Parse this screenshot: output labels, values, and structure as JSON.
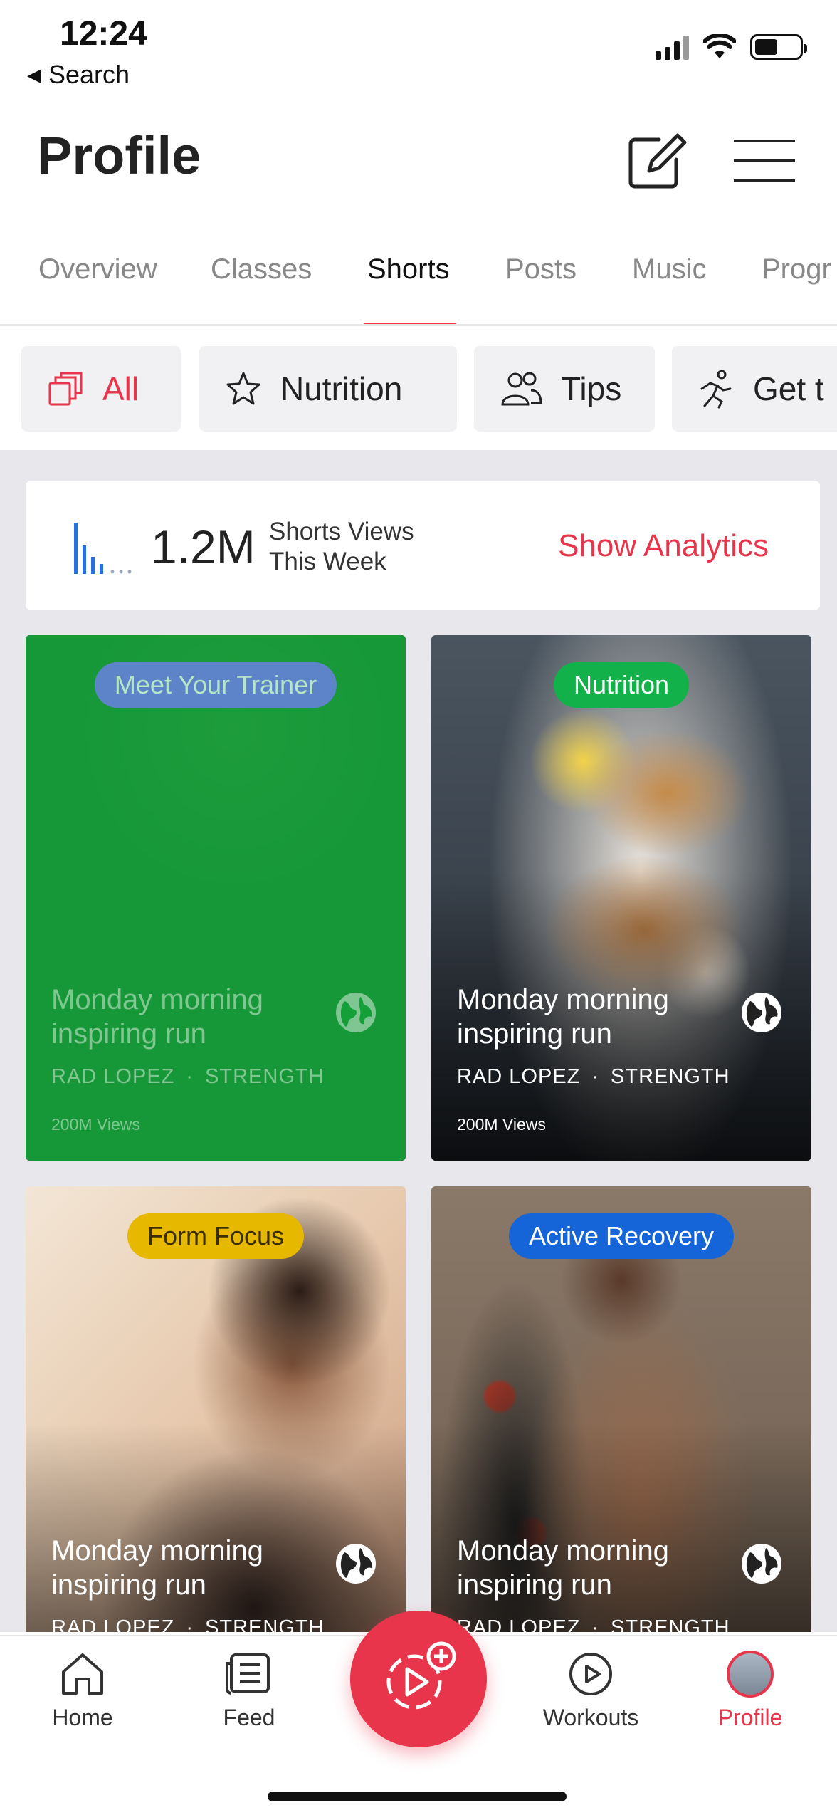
{
  "status_bar": {
    "time": "12:24",
    "back_label": "Search",
    "icons": [
      "cellular-signal-icon",
      "wifi-icon",
      "battery-icon"
    ]
  },
  "header": {
    "title": "Profile",
    "actions": [
      "edit-icon",
      "menu-icon"
    ]
  },
  "tabs": [
    {
      "label": "Overview",
      "active": false
    },
    {
      "label": "Classes",
      "active": false
    },
    {
      "label": "Shorts",
      "active": true
    },
    {
      "label": "Posts",
      "active": false
    },
    {
      "label": "Music",
      "active": false
    },
    {
      "label": "Progr",
      "active": false
    }
  ],
  "filters": [
    {
      "label": "All",
      "icon": "stacked-squares-icon",
      "active": true
    },
    {
      "label": "Nutrition",
      "icon": "star-icon",
      "active": false
    },
    {
      "label": "Tips",
      "icon": "people-icon",
      "active": false
    },
    {
      "label": "Get t",
      "icon": "runner-icon",
      "active": false
    }
  ],
  "analytics": {
    "value": "1.2M",
    "label": "Shorts Views This Week",
    "link": "Show Analytics"
  },
  "cards": [
    {
      "badge": "Meet Your Trainer",
      "title": "Monday morning inspiring run",
      "instructor": "RAD LOPEZ",
      "category": "STRENGTH",
      "views": "200M Views",
      "badge_color": "#5d84c9",
      "badge_text_color": "#b6e6c6",
      "state": "faded"
    },
    {
      "badge": "Nutrition",
      "title": "Monday morning inspiring run",
      "instructor": "RAD LOPEZ",
      "category": "STRENGTH",
      "views": "200M Views",
      "badge_color": "#12b14a",
      "badge_text_color": "#ffffff",
      "state": "normal"
    },
    {
      "badge": "Form Focus",
      "title": "Monday morning inspiring run",
      "instructor": "RAD LOPEZ",
      "category": "STRENGTH",
      "views": "",
      "badge_color": "#e6b900",
      "badge_text_color": "#3b2f00",
      "state": "normal"
    },
    {
      "badge": "Active Recovery",
      "title": "Monday morning inspiring run",
      "instructor": "RAD LOPEZ",
      "category": "STRENGTH",
      "views": "",
      "badge_color": "#1565d8",
      "badge_text_color": "#ffffff",
      "state": "normal"
    }
  ],
  "bottom_nav": [
    {
      "label": "Home",
      "icon": "home-icon",
      "active": false
    },
    {
      "label": "Feed",
      "icon": "feed-icon",
      "active": false
    },
    {
      "label": "",
      "icon": "create-short-icon",
      "active": false
    },
    {
      "label": "Workouts",
      "icon": "play-circle-icon",
      "active": false
    },
    {
      "label": "Profile",
      "icon": "avatar",
      "active": true
    }
  ],
  "colors": {
    "accent": "#e8354b",
    "analytics_bars": "#2a6fe0",
    "content_bg": "#e8e8ec"
  }
}
